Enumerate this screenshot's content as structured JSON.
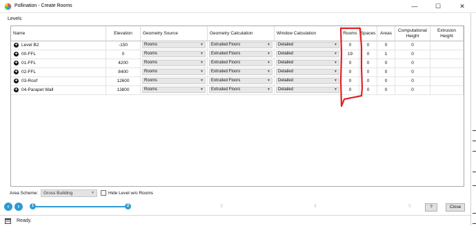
{
  "window": {
    "title": "Pollination - Create Rooms",
    "minimize": "—",
    "maximize": "☐",
    "close": "✕"
  },
  "levels_label": "Levels",
  "table": {
    "headers": {
      "name": "Name",
      "elevation": "Elevation",
      "geometry_source": "Geometry Source",
      "geometry_calculation": "Geometry Calculation",
      "window_calculation": "Window Calculation",
      "rooms": "Rooms",
      "spaces": "Spaces",
      "areas": "Areas",
      "computational_height": "Computational Height",
      "extrusion_height": "Extrusion Height"
    },
    "rows": [
      {
        "name": "Level B2",
        "elevation": "-150",
        "geometry_source": "Rooms",
        "geometry_calculation": "Extruded Floors",
        "window_calculation": "Detailed",
        "rooms": "0",
        "spaces": "0",
        "areas": "0",
        "computational_height": "0",
        "extrusion_height": ""
      },
      {
        "name": "00-FFL",
        "elevation": "0",
        "geometry_source": "Rooms",
        "geometry_calculation": "Extruded Floors",
        "window_calculation": "Detailed",
        "rooms": "19",
        "spaces": "0",
        "areas": "1",
        "computational_height": "0",
        "extrusion_height": ""
      },
      {
        "name": "01-FFL",
        "elevation": "4200",
        "geometry_source": "Rooms",
        "geometry_calculation": "Extruded Floors",
        "window_calculation": "Detailed",
        "rooms": "0",
        "spaces": "0",
        "areas": "0",
        "computational_height": "0",
        "extrusion_height": ""
      },
      {
        "name": "02-FFL",
        "elevation": "8400",
        "geometry_source": "Rooms",
        "geometry_calculation": "Extruded Floors",
        "window_calculation": "Detailed",
        "rooms": "0",
        "spaces": "0",
        "areas": "0",
        "computational_height": "0",
        "extrusion_height": ""
      },
      {
        "name": "03-Roof",
        "elevation": "12600",
        "geometry_source": "Rooms",
        "geometry_calculation": "Extruded Floors",
        "window_calculation": "Detailed",
        "rooms": "0",
        "spaces": "0",
        "areas": "0",
        "computational_height": "0",
        "extrusion_height": ""
      },
      {
        "name": "04-Parapet Wall",
        "elevation": "13800",
        "geometry_source": "Rooms",
        "geometry_calculation": "Extruded Floors",
        "window_calculation": "Detailed",
        "rooms": "0",
        "spaces": "0",
        "areas": "0",
        "computational_height": "0",
        "extrusion_height": ""
      }
    ]
  },
  "footer": {
    "area_scheme_label": "Area Scheme:",
    "area_scheme_value": "Gross Building",
    "hide_level_label": "Hide Level w/o Rooms",
    "hide_level_checked": false
  },
  "wizard": {
    "back": "‹",
    "forward": "›",
    "steps": [
      "1",
      "2",
      "3",
      "4",
      "5"
    ],
    "current_step": 2
  },
  "buttons": {
    "help": "?",
    "close": "Close"
  },
  "status": {
    "text": "Ready."
  },
  "colors": {
    "accent": "#2d9bd4",
    "annotation": "#e02020"
  }
}
